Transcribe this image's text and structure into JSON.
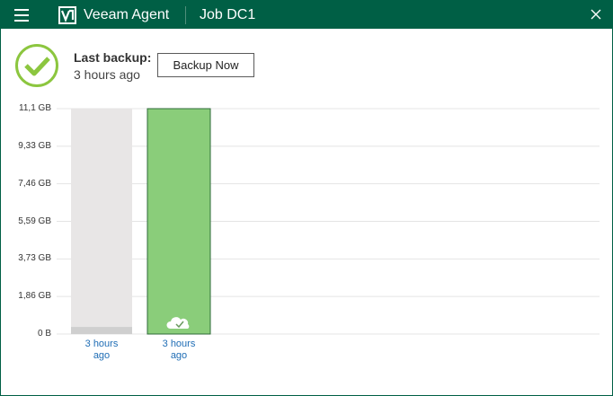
{
  "titlebar": {
    "app_title": "Veeam Agent",
    "job_title": "Job DC1",
    "menu_icon": "hamburger-icon",
    "close_icon": "close-icon",
    "background": "#005f45"
  },
  "status": {
    "icon": "check-circle-icon",
    "label": "Last backup:",
    "value": "3 hours ago",
    "color": "#8cc63f"
  },
  "toolbar": {
    "backup_now_label": "Backup Now"
  },
  "chart_data": {
    "type": "bar",
    "y_ticks": [
      "0 B",
      "1,86 GB",
      "3,73 GB",
      "5,59 GB",
      "7,46 GB",
      "9,33 GB",
      "11,1 GB"
    ],
    "ylim_gb": [
      0,
      11.1
    ],
    "grid": true,
    "bars": [
      {
        "label_line1": "3 hours",
        "label_line2": "ago",
        "value_gb": 0.35,
        "track_gb": 11.1,
        "color": "#cfcfcf",
        "track_color": "#e8e6e6",
        "selected": false
      },
      {
        "label_line1": "3 hours",
        "label_line2": "ago",
        "value_gb": 11.1,
        "track_gb": 11.1,
        "color": "#8acd7a",
        "track_color": "#8acd7a",
        "icon": "cloud-check-icon",
        "selected": true
      }
    ]
  }
}
